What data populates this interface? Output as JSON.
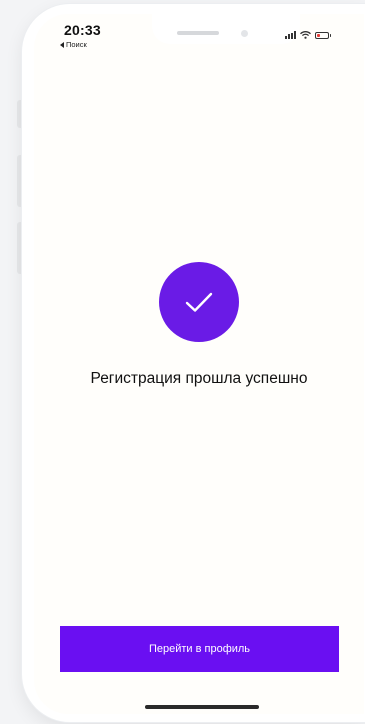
{
  "status_bar": {
    "time": "20:33",
    "back_label": "Поиск",
    "icons": [
      "signal-icon",
      "wifi-icon",
      "battery-icon"
    ],
    "battery_color": "#e53935"
  },
  "main": {
    "success_icon": "checkmark-icon",
    "success_color": "#6a1be6",
    "message": "Регистрация прошла успешно"
  },
  "footer": {
    "button_label": "Перейти в профиль",
    "button_color": "#6a0ff2"
  }
}
